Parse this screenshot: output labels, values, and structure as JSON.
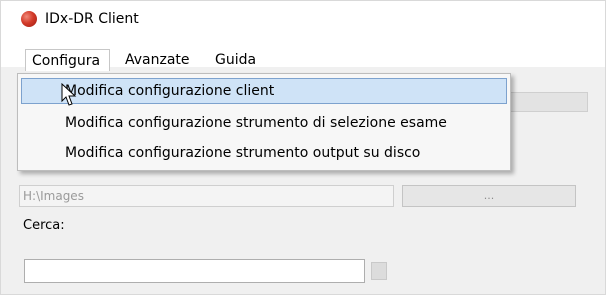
{
  "window": {
    "title": "IDx-DR Client",
    "icon": "app-red-circle-icon"
  },
  "menubar": {
    "items": [
      {
        "label": "Configura"
      },
      {
        "label": "Avanzate"
      },
      {
        "label": "Guida"
      }
    ]
  },
  "dropdown": {
    "items": [
      {
        "label": "Modifica configurazione client"
      },
      {
        "label": "Modifica configurazione strumento di selezione esame"
      },
      {
        "label": "Modifica configurazione strumento output su disco"
      }
    ],
    "highlight_color": "#cfe3f7"
  },
  "form": {
    "path_value": "H:\\Images",
    "browse_label": "...",
    "search_label": "Cerca:",
    "search_value": ""
  }
}
